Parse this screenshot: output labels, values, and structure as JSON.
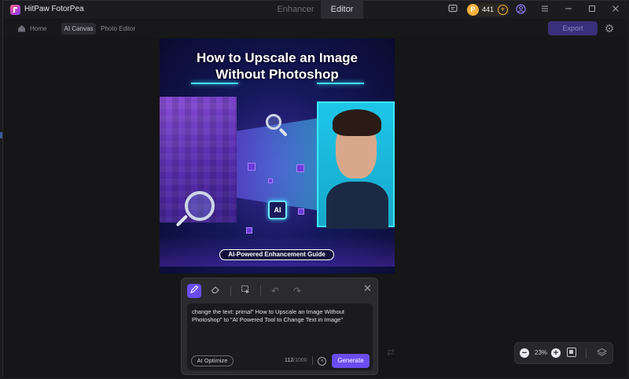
{
  "app": {
    "name": "HitPaw FotorPea"
  },
  "tabs": [
    {
      "label": "Enhancer"
    },
    {
      "label": "Editor"
    }
  ],
  "credits": {
    "count": "441"
  },
  "nav": {
    "home": "Home",
    "ai_canvas": "AI Canvas",
    "photo_editor": "Photo Editor"
  },
  "toolbar": {
    "export_label": "Export"
  },
  "image": {
    "title_line1": "How to Upscale an Image",
    "title_line2": "Without Photoshop",
    "chip_label": "AI",
    "badge": "AI-Powered Enhancement Guide"
  },
  "prompt": {
    "text": "change the text: primal\" How to Upscale an Image Without Photoshop\" to \"AI Powered Tool to Change Text in Image\"",
    "optimize_label": "AI Optimize",
    "char_count": "112",
    "char_max": "/1000",
    "generate_label": "Generate"
  },
  "zoom": {
    "value": "23%"
  },
  "colors": {
    "accent": "#6a4df0",
    "coin": "#f3b33d",
    "cyan": "#3fe6ff"
  }
}
